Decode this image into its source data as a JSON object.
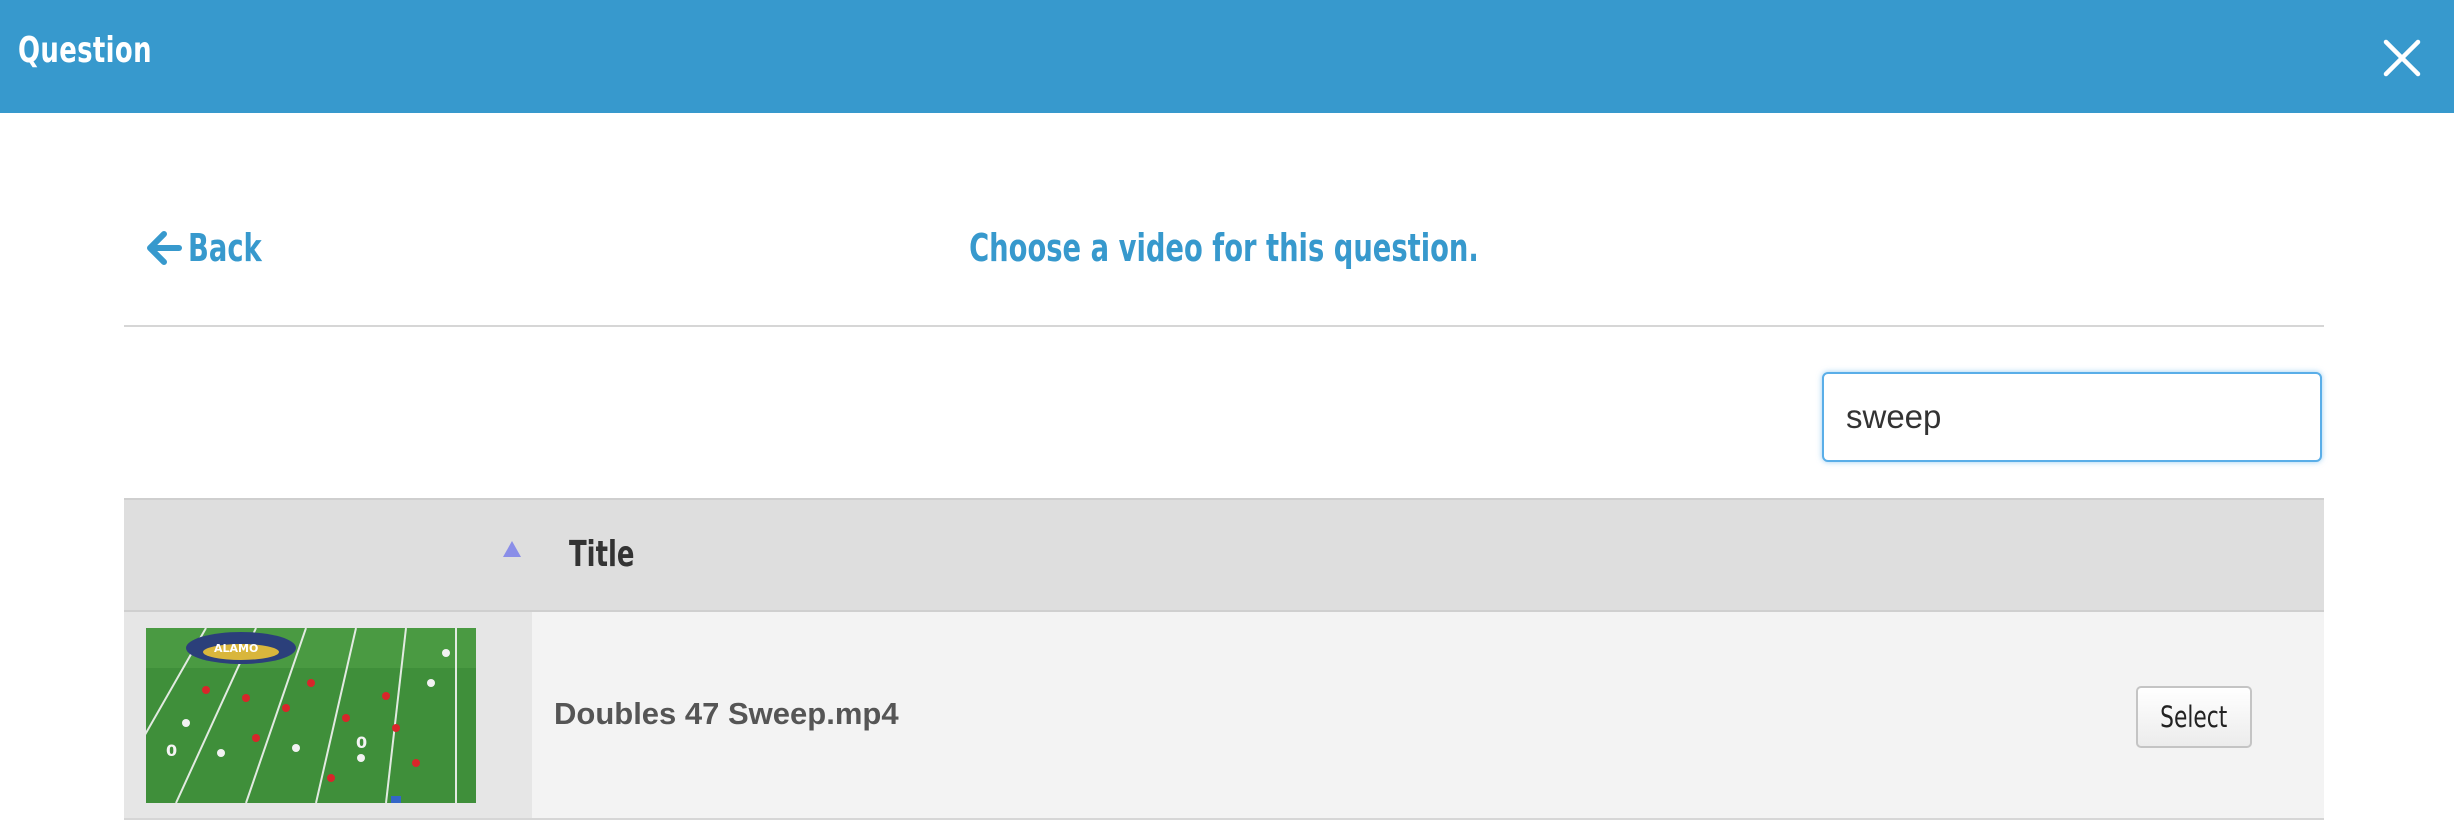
{
  "header": {
    "title": "Question",
    "close_icon": "close-icon",
    "background_color": "#3799cd"
  },
  "nav": {
    "back_label": "Back",
    "back_icon": "arrow-left-icon",
    "heading": "Choose a video for this question."
  },
  "search": {
    "value": "sweep",
    "placeholder": ""
  },
  "table": {
    "sort_icon": "sort-ascending-icon",
    "columns": [
      "",
      "Title"
    ],
    "rows": [
      {
        "thumbnail": "football-field-thumbnail",
        "title": "Doubles 47 Sweep.mp4",
        "action_label": "Select"
      }
    ]
  },
  "colors": {
    "accent": "#3799cd",
    "header_row": "#dedede",
    "body_row": "#f3f3f3"
  }
}
